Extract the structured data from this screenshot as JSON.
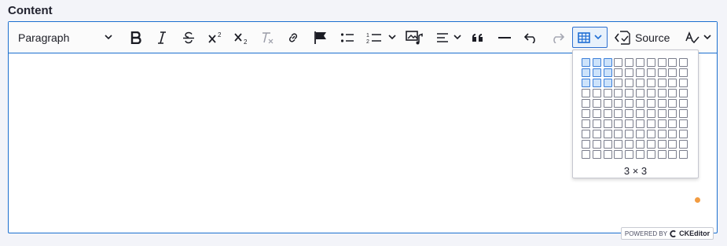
{
  "field": {
    "label": "Content"
  },
  "toolbar": {
    "heading_value": "Paragraph",
    "source_label": "Source",
    "icons": [
      "bold-icon",
      "italic-icon",
      "strikethrough-icon",
      "superscript-icon",
      "subscript-icon",
      "remove-format-icon",
      "link-icon",
      "flag-icon",
      "bulleted-list-icon",
      "numbered-list-icon",
      "media-icon",
      "align-icon",
      "blockquote-icon",
      "horizontal-line-icon",
      "undo-icon",
      "redo-icon",
      "table-icon",
      "source-icon",
      "spellcheck-icon"
    ]
  },
  "table_insert": {
    "rows": 10,
    "columns": 10,
    "selected_rows": 3,
    "selected_columns": 3,
    "size_label": "3 × 3"
  },
  "footer": {
    "powered_by": "POWERED BY",
    "brand": "CKEditor"
  },
  "colors": {
    "accent": "#1b6fcf",
    "selected_cell": "#cde3fb",
    "badge_dot": "#f29c41",
    "background": "#f3f4f9"
  }
}
